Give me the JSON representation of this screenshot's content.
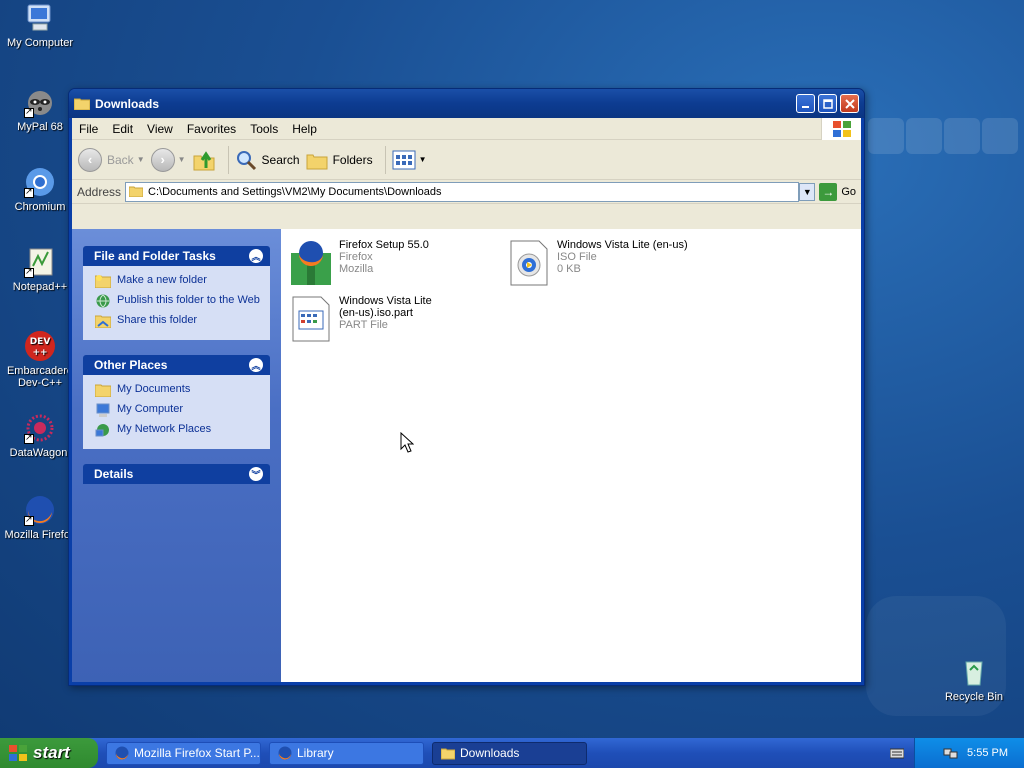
{
  "desktop": {
    "icons": [
      {
        "label": "My Computer"
      },
      {
        "label": "MyPal 68"
      },
      {
        "label": "Chromium"
      },
      {
        "label": "Notepad++"
      },
      {
        "label": "Embarcadero Dev-C++"
      },
      {
        "label": "DataWagon."
      },
      {
        "label": "Mozilla Firefox"
      },
      {
        "label": "Recycle Bin"
      }
    ]
  },
  "window": {
    "title": "Downloads",
    "menu": [
      "File",
      "Edit",
      "View",
      "Favorites",
      "Tools",
      "Help"
    ],
    "toolbar": {
      "back": "Back",
      "search": "Search",
      "folders": "Folders"
    },
    "address": {
      "label": "Address",
      "value": "C:\\Documents and Settings\\VM2\\My Documents\\Downloads",
      "go": "Go"
    },
    "taskpane": {
      "file_tasks": {
        "title": "File and Folder Tasks",
        "items": [
          "Make a new folder",
          "Publish this folder to the Web",
          "Share this folder"
        ]
      },
      "other_places": {
        "title": "Other Places",
        "items": [
          "My Documents",
          "My Computer",
          "My Network Places"
        ]
      },
      "details": {
        "title": "Details"
      }
    },
    "files": [
      {
        "name": "Firefox Setup 55.0",
        "line2": "Firefox",
        "line3": "Mozilla"
      },
      {
        "name": "Windows Vista Lite (en-us)",
        "line2": "ISO File",
        "line3": "0 KB"
      },
      {
        "name": "Windows Vista Lite (en-us).iso.part",
        "line2": "PART File",
        "line3": ""
      }
    ]
  },
  "taskbar": {
    "start": "start",
    "tasks": [
      "Mozilla Firefox Start P...",
      "Library",
      "Downloads"
    ],
    "clock": "5:55 PM"
  }
}
